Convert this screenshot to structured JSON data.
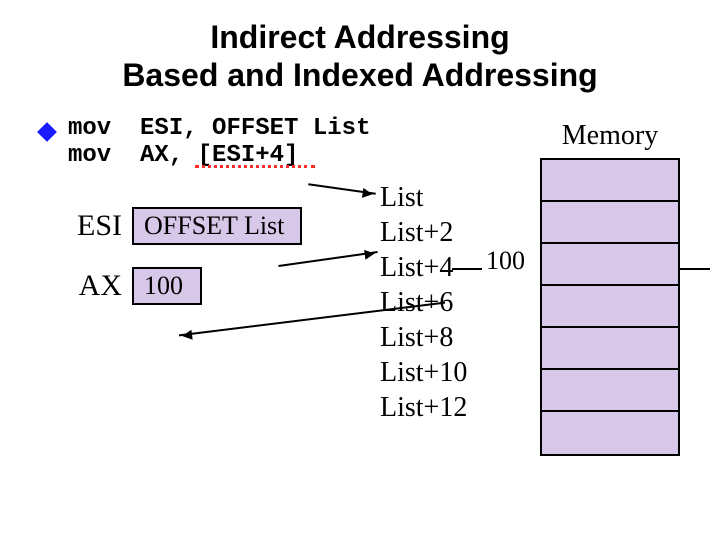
{
  "title_line1": "Indirect Addressing",
  "title_line2": "Based and Indexed Addressing",
  "code": {
    "line1_mnemonic": "mov",
    "line1_args": "ESI, OFFSET List",
    "line2_mnemonic": "mov",
    "line2_args": "AX, [ESI+4]"
  },
  "registers": {
    "esi_label": "ESI",
    "esi_value": "OFFSET List",
    "ax_label": "AX",
    "ax_value": "100"
  },
  "addresses": [
    "List",
    "List+2",
    "List+4",
    "List+6",
    "List+8",
    "List+10",
    "List+12"
  ],
  "memory": {
    "header": "Memory",
    "highlight_value": "100",
    "row_count": 7
  }
}
